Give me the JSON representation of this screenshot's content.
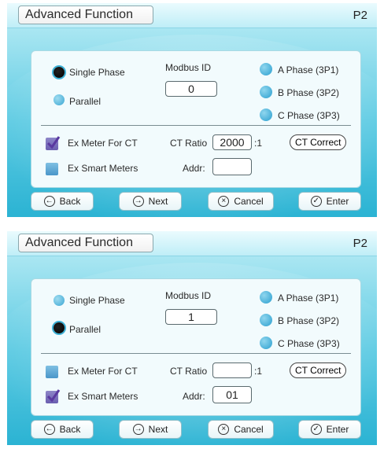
{
  "screens": [
    {
      "title": "Advanced Function",
      "page": "P2",
      "mode_options": [
        {
          "label": "Single Phase",
          "selected": true
        },
        {
          "label": "Parallel",
          "selected": false
        }
      ],
      "modbus": {
        "label": "Modbus ID",
        "value": "0"
      },
      "phases": [
        "A Phase (3P1)",
        "B Phase (3P2)",
        "C Phase (3P3)"
      ],
      "ex_meter_ct": {
        "label": "Ex Meter For CT",
        "checked": true
      },
      "ex_smart": {
        "label": "Ex Smart Meters",
        "checked": false
      },
      "ct_ratio": {
        "label": "CT Ratio",
        "value": "2000",
        "suffix": ":1"
      },
      "ct_correct_label": "CT Correct",
      "addr": {
        "label": "Addr:",
        "value": ""
      },
      "buttons": {
        "back": "Back",
        "next": "Next",
        "cancel": "Cancel",
        "enter": "Enter"
      }
    },
    {
      "title": "Advanced Function",
      "page": "P2",
      "mode_options": [
        {
          "label": "Single Phase",
          "selected": false
        },
        {
          "label": "Parallel",
          "selected": true
        }
      ],
      "modbus": {
        "label": "Modbus ID",
        "value": "1"
      },
      "phases": [
        "A Phase (3P1)",
        "B Phase (3P2)",
        "C Phase (3P3)"
      ],
      "ex_meter_ct": {
        "label": "Ex Meter For CT",
        "checked": false
      },
      "ex_smart": {
        "label": "Ex Smart Meters",
        "checked": true
      },
      "ct_ratio": {
        "label": "CT Ratio",
        "value": "",
        "suffix": ":1"
      },
      "ct_correct_label": "CT Correct",
      "addr": {
        "label": "Addr:",
        "value": "01"
      },
      "buttons": {
        "back": "Back",
        "next": "Next",
        "cancel": "Cancel",
        "enter": "Enter"
      }
    }
  ],
  "icons": {
    "back": "arrow-left-circle-icon",
    "next": "arrow-right-circle-icon",
    "cancel": "x-circle-icon",
    "enter": "check-circle-icon"
  },
  "colors": {
    "accent": "#2bb3d3",
    "panel": "#f2fbfd",
    "check_on": "#6a5eb0"
  }
}
